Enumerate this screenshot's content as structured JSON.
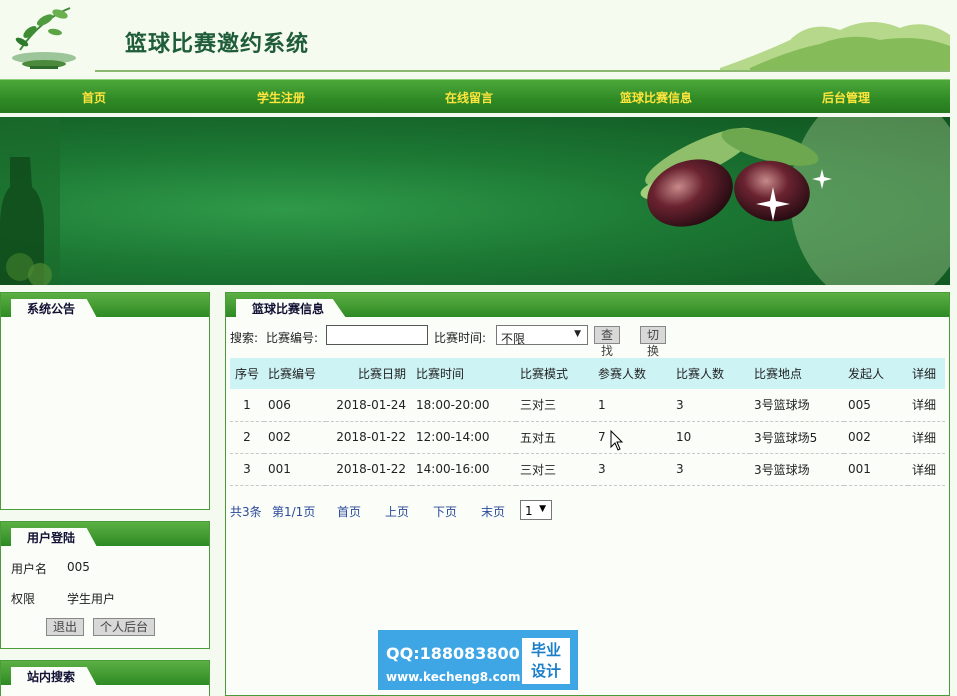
{
  "site": {
    "title": "篮球比赛邀约系统"
  },
  "nav": [
    "首页",
    "学生注册",
    "在线留言",
    "篮球比赛信息",
    "后台管理"
  ],
  "sidebar": {
    "notice_title": "系统公告",
    "login_title": "用户登陆",
    "username_label": "用户名",
    "username_value": "005",
    "role_label": "权限",
    "role_value": "学生用户",
    "logout_button": "退出",
    "profile_button": "个人后台",
    "site_search_title": "站内搜索"
  },
  "main": {
    "title": "篮球比赛信息",
    "search": {
      "label": "搜索:",
      "code_label": "比赛编号:",
      "code_value": "",
      "time_label": "比赛时间:",
      "time_selected": "不限",
      "find_button": "查找",
      "switch_view_button": "切换视图"
    },
    "table": {
      "headers": [
        "序号",
        "比赛编号",
        "比赛日期",
        "比赛时间",
        "比赛模式",
        "参赛人数",
        "比赛人数",
        "比赛地点",
        "发起人",
        "详细"
      ],
      "rows": [
        [
          "1",
          "006",
          "2018-01-24",
          "18:00-20:00",
          "三对三",
          "1",
          "3",
          "3号篮球场",
          "005",
          "详细"
        ],
        [
          "2",
          "002",
          "2018-01-22",
          "12:00-14:00",
          "五对五",
          "7",
          "10",
          "3号篮球场5",
          "002",
          "详细"
        ],
        [
          "3",
          "001",
          "2018-01-22",
          "14:00-16:00",
          "三对三",
          "3",
          "3",
          "3号篮球场",
          "001",
          "详细"
        ]
      ]
    },
    "pager": {
      "total": "共3条",
      "page_info": "第1/1页",
      "first": "首页",
      "prev": "上页",
      "next": "下页",
      "last": "末页",
      "page_selected": "1"
    }
  },
  "watermark": {
    "qq": "QQ:188083800",
    "url": "www.kecheng8.com",
    "badge_line1": "毕业",
    "badge_line2": "设计"
  },
  "colors": {
    "nav_text": "#ffe53d",
    "nav_bg": "#2f8a25",
    "title": "#1f5d3a",
    "table_header": "#cdf3f5",
    "link": "#2a4a9a"
  }
}
